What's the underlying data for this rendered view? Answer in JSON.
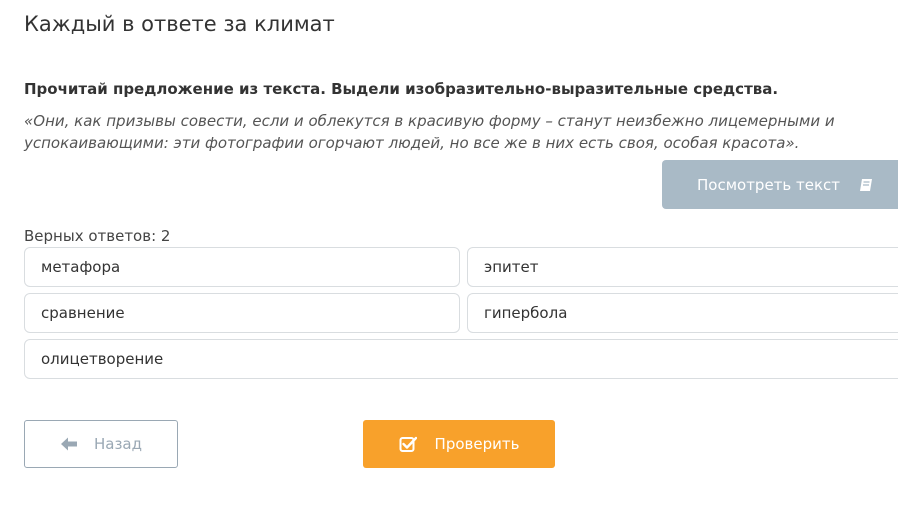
{
  "header": {
    "title": "Каждый в ответе за климат"
  },
  "task": {
    "instruction": "Прочитай предложение из текста. Выдели изобразительно-выразительные средства.",
    "quote": "«Они, как призывы совести, если и облекутся в красивую форму – станут неизбежно лицемерными и успокаивающими: эти фотографии огорчают людей, но все же в них есть своя, особая красота».",
    "view_text_label": "Посмотреть текст",
    "view_text_icon": "book-icon"
  },
  "answers": {
    "correct_count_label": "Верных ответов: 2",
    "options": [
      {
        "label": "метафора"
      },
      {
        "label": "эпитет"
      },
      {
        "label": "сравнение"
      },
      {
        "label": "гипербола"
      },
      {
        "label": "олицетворение"
      }
    ]
  },
  "footer": {
    "back_label": "Назад",
    "back_icon": "arrow-left-icon",
    "check_label": "Проверить",
    "check_icon": "checkbox-icon"
  },
  "colors": {
    "view_text_bg": "#a9bac6",
    "check_bg": "#f8a12b",
    "back_border": "#9aa8b4"
  }
}
